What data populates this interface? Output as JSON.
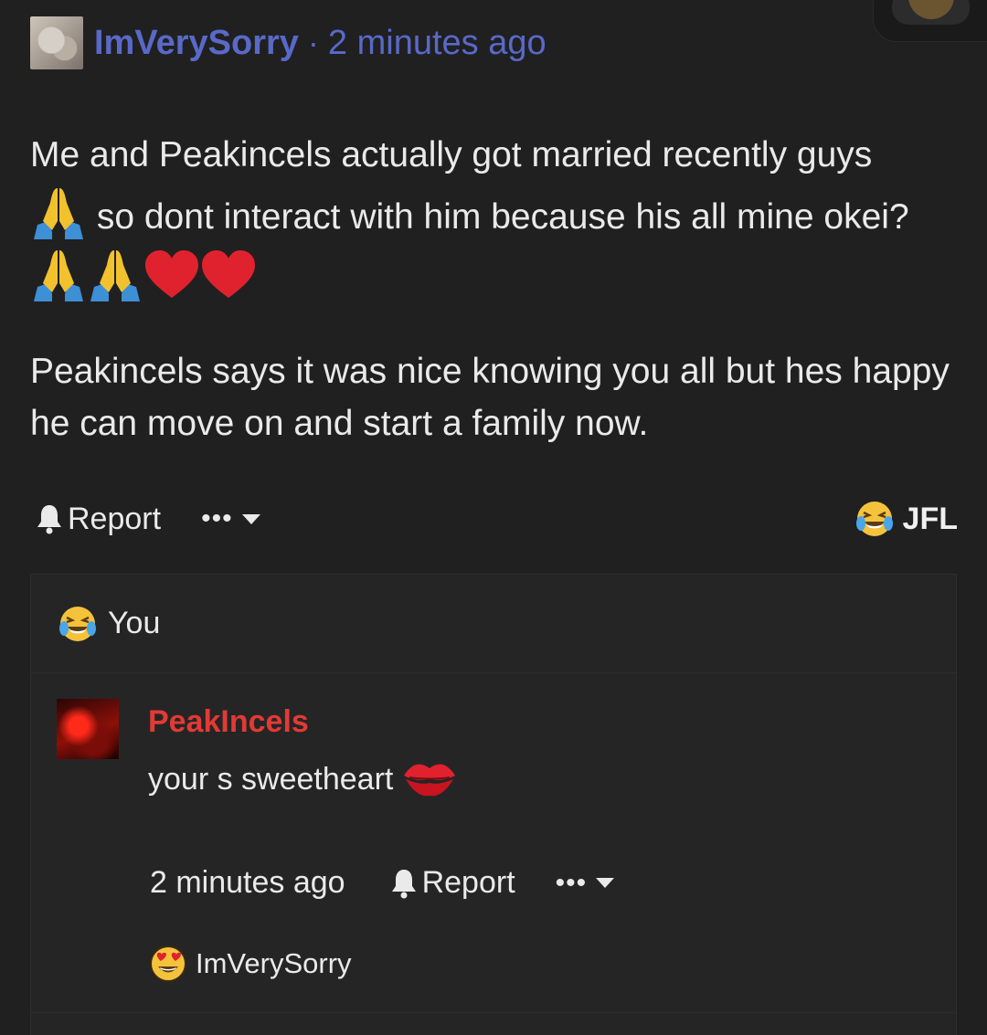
{
  "post": {
    "username": "ImVerySorry",
    "separator": "·",
    "time": "2 minutes ago",
    "body_line1": "Me and Peakincels actually got married recently guys",
    "body_line2": "so dont interact with him because his all mine okei?",
    "body_para2": "Peakincels says it was nice knowing you all but hes happy he can move on and start a family now.",
    "emojis": [
      "folded-hands",
      "folded-hands",
      "folded-hands",
      "red-heart",
      "red-heart"
    ]
  },
  "actions": {
    "report_label": "Report",
    "more_label": "•••",
    "reaction_label": "JFL"
  },
  "comment_box": {
    "reactor_label": "You",
    "reply": {
      "username": "PeakIncels",
      "text": "your s sweetheart",
      "time": "2 minutes ago",
      "report_label": "Report",
      "more_label": "•••",
      "reactor_label": "ImVerySorry"
    }
  },
  "colors": {
    "background": "#202021",
    "username_blue": "#5969c8",
    "reply_username_red": "#e23a34",
    "text": "#eaeaea"
  }
}
